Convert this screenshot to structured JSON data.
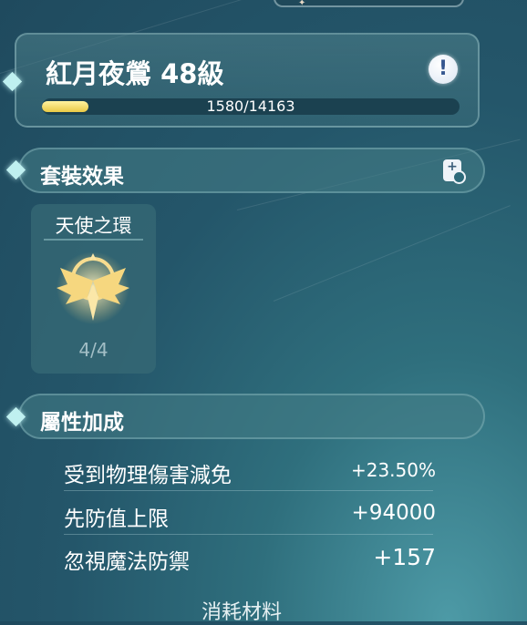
{
  "character": {
    "name": "紅月夜鶯 48級",
    "xp_text": "1580/14163",
    "xp_fraction": 0.112,
    "info_icon": "exclamation-info-icon",
    "info_glyph": "!"
  },
  "set_section": {
    "title": "套裝效果",
    "filter_icon": "card-search-icon",
    "filter_glyph": "+",
    "card": {
      "name": "天使之環",
      "count": "4/4",
      "icon": "winged-halo-emblem-icon"
    }
  },
  "attribute_section": {
    "title": "屬性加成",
    "stats": [
      {
        "label": "受到物理傷害減免",
        "value": "+23.50%"
      },
      {
        "label": "先防值上限",
        "value": "+94000"
      },
      {
        "label": "忽視魔法防禦",
        "value": "+157"
      }
    ]
  },
  "footer": {
    "label": "消耗材料"
  },
  "colors": {
    "xp_fill": "#e9c945",
    "accent_diamond": "#bff0f0",
    "emblem_gold": "#f3d27a"
  }
}
